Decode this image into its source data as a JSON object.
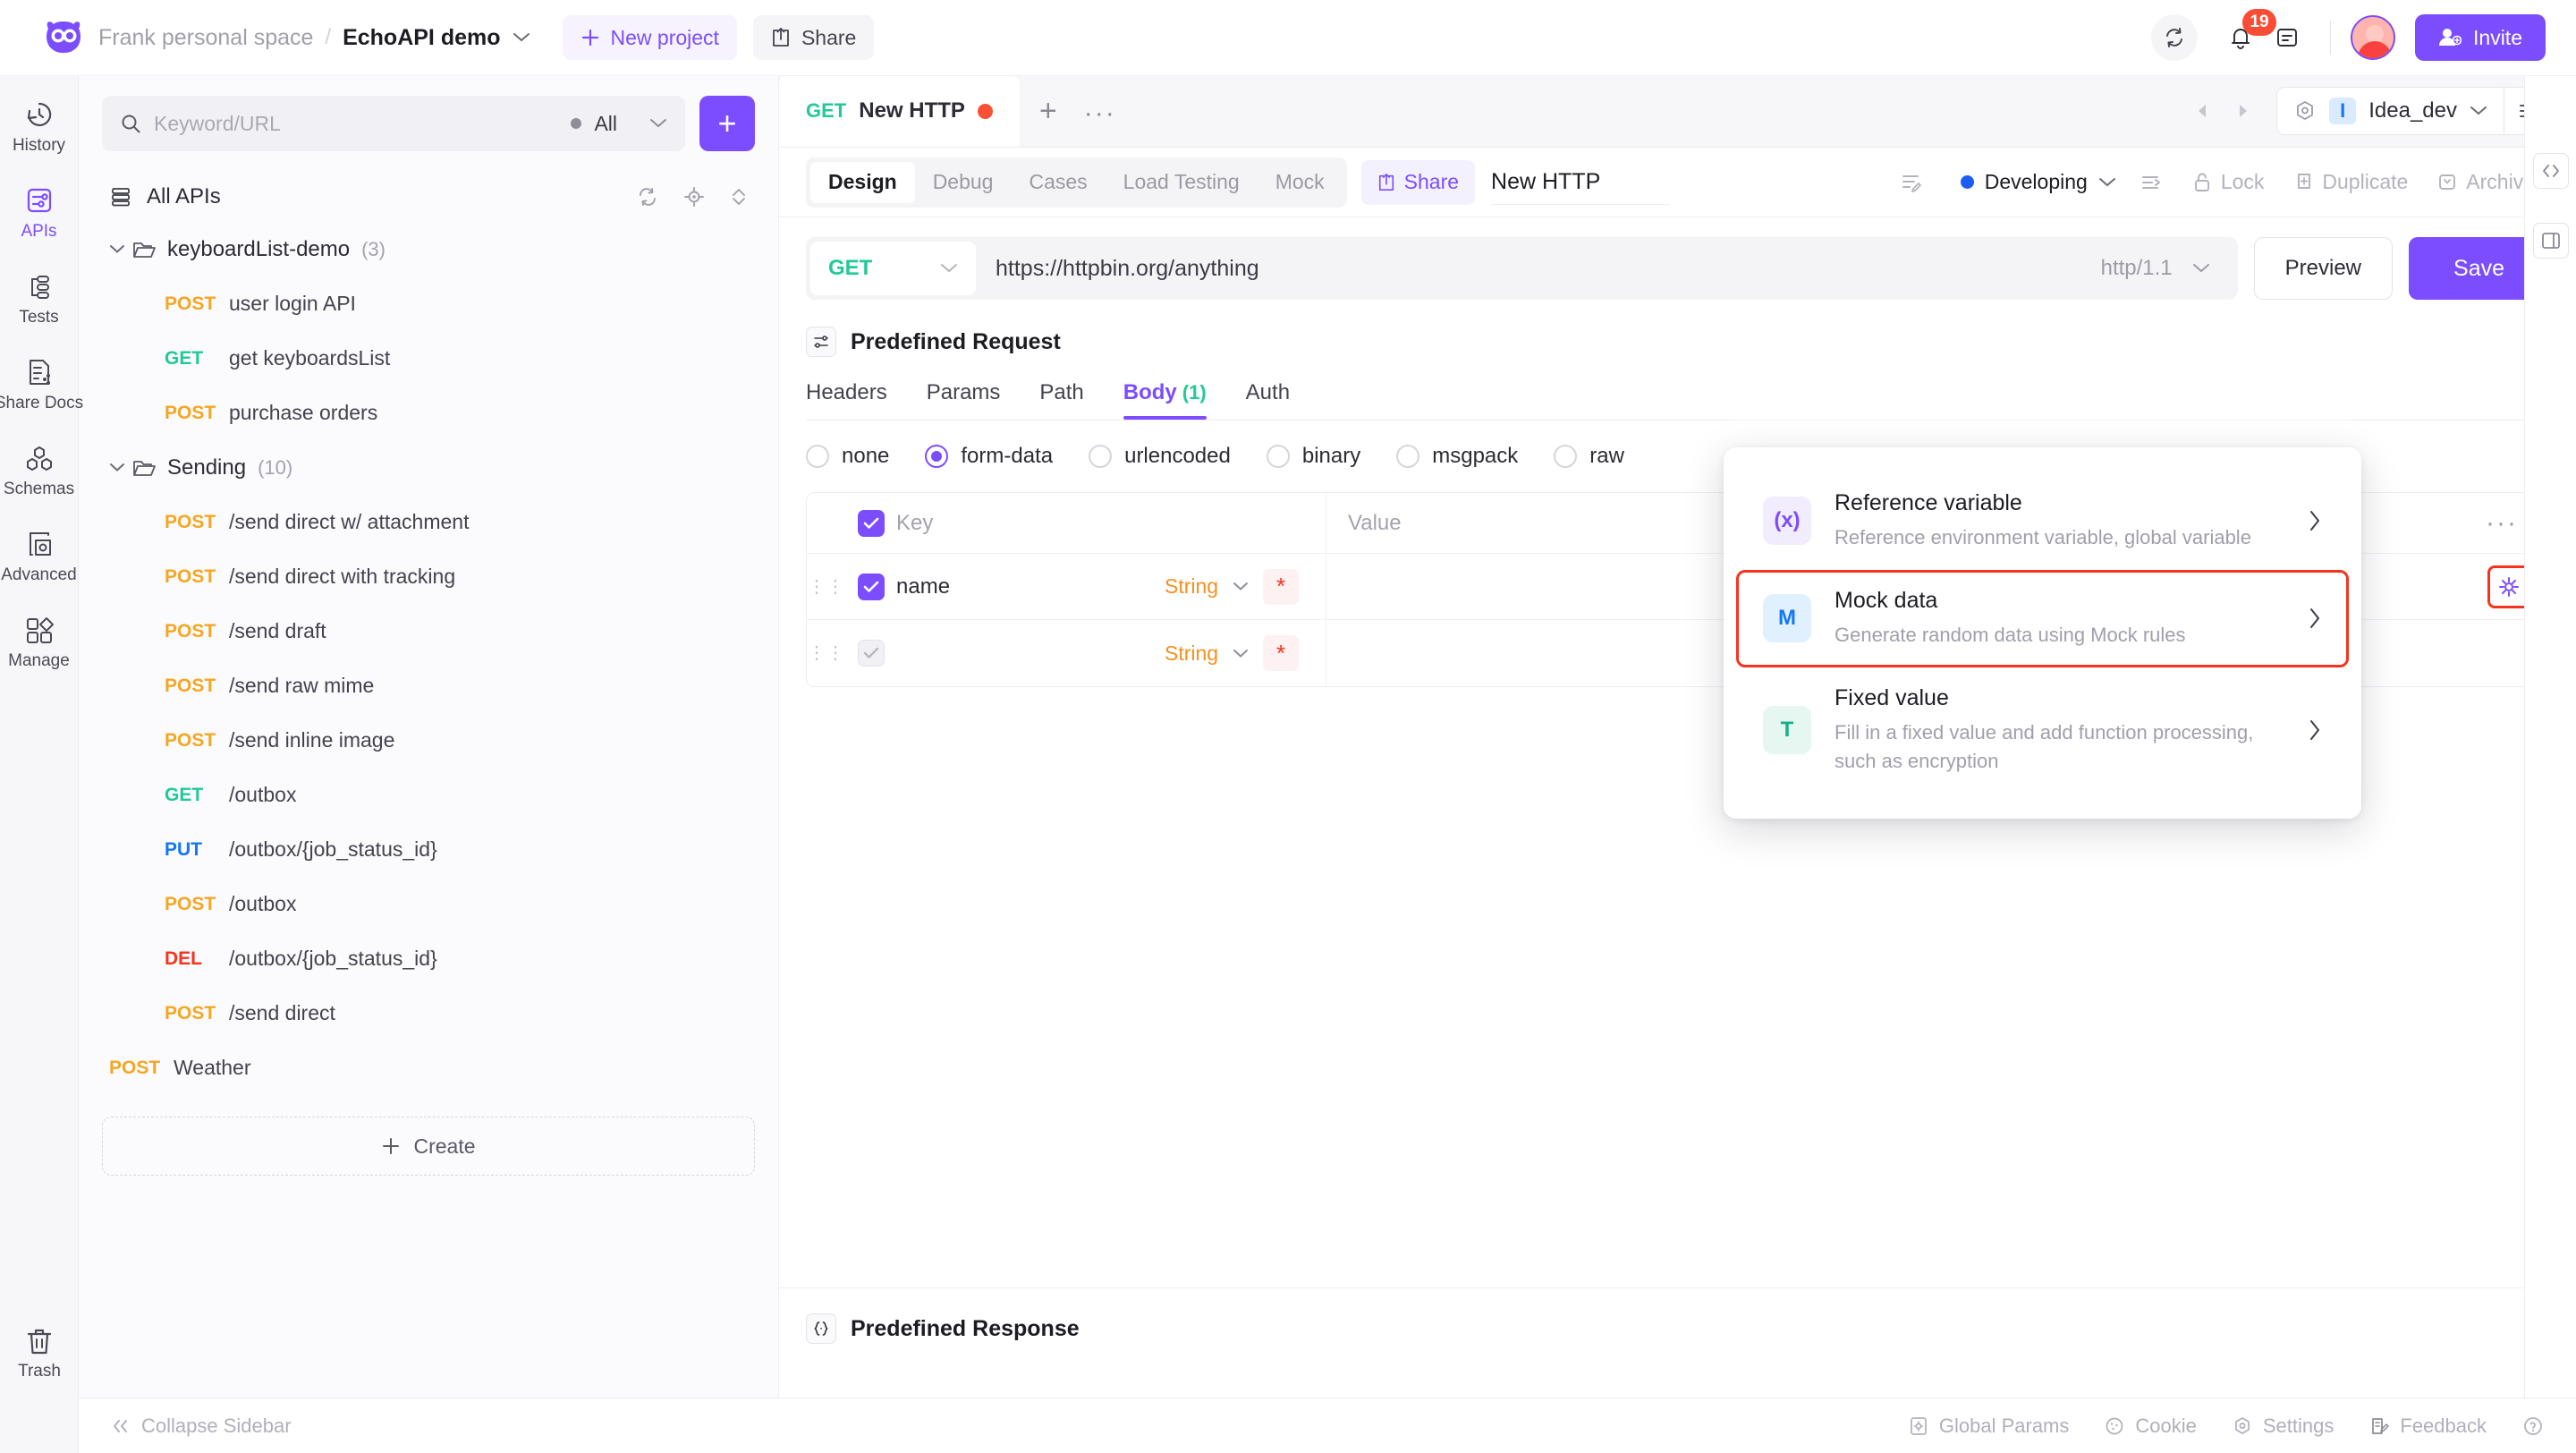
{
  "header": {
    "workspace": "Frank personal space",
    "separator": "/",
    "project": "EchoAPI demo",
    "new_project_label": "New project",
    "share_label": "Share",
    "notification_count": "19",
    "invite_label": "Invite",
    "icons": [
      "sync-icon",
      "bell-icon",
      "notes-icon",
      "avatar",
      "invite-user-icon"
    ]
  },
  "rail": {
    "items": [
      {
        "label": "History",
        "icon": "history-icon",
        "active": false
      },
      {
        "label": "APIs",
        "icon": "sliders-icon",
        "active": true
      },
      {
        "label": "Tests",
        "icon": "flow-icon",
        "active": false
      },
      {
        "label": "Share Docs",
        "icon": "share-doc-icon",
        "active": false
      },
      {
        "label": "Schemas",
        "icon": "schema-icon",
        "active": false
      },
      {
        "label": "Advanced",
        "icon": "advanced-icon",
        "active": false
      },
      {
        "label": "Manage",
        "icon": "manage-icon",
        "active": false
      }
    ],
    "trash_label": "Trash"
  },
  "sidebar": {
    "search_placeholder": "Keyword/URL",
    "filter_label": "All",
    "add_button": "+",
    "all_apis_label": "All APIs",
    "create_label": "Create",
    "tree": [
      {
        "type": "folder",
        "name": "keyboardList-demo",
        "count": "(3)",
        "expanded": true
      },
      {
        "type": "api",
        "method": "POST",
        "name": "user login API"
      },
      {
        "type": "api",
        "method": "GET",
        "name": "get keyboardsList"
      },
      {
        "type": "api",
        "method": "POST",
        "name": "purchase orders"
      },
      {
        "type": "folder",
        "name": "Sending",
        "count": "(10)",
        "expanded": true
      },
      {
        "type": "api",
        "method": "POST",
        "name": "/send direct w/ attachment"
      },
      {
        "type": "api",
        "method": "POST",
        "name": "/send direct with tracking"
      },
      {
        "type": "api",
        "method": "POST",
        "name": "/send draft"
      },
      {
        "type": "api",
        "method": "POST",
        "name": "/send raw mime"
      },
      {
        "type": "api",
        "method": "POST",
        "name": "/send inline image"
      },
      {
        "type": "api",
        "method": "GET",
        "name": "/outbox"
      },
      {
        "type": "api",
        "method": "PUT",
        "name": "/outbox/{job_status_id}"
      },
      {
        "type": "api",
        "method": "POST",
        "name": "/outbox"
      },
      {
        "type": "api",
        "method": "DEL",
        "name": "/outbox/{job_status_id}"
      },
      {
        "type": "api",
        "method": "POST",
        "name": "/send direct"
      },
      {
        "type": "api-root",
        "method": "POST",
        "name": "Weather"
      }
    ]
  },
  "doctab": {
    "method": "GET",
    "title": "New HTTP",
    "unsaved": true,
    "add_tab": "+",
    "more_tabs": "···"
  },
  "environment": {
    "chip": "I",
    "name": "Idea_dev"
  },
  "subtabs": {
    "tabs": [
      "Design",
      "Debug",
      "Cases",
      "Load Testing",
      "Mock"
    ],
    "active": "Design",
    "share_label": "Share",
    "name_value": "New HTTP",
    "status_label": "Developing",
    "actions": [
      "Lock",
      "Duplicate",
      "Archive"
    ]
  },
  "request": {
    "method": "GET",
    "url": "https://httpbin.org/anything",
    "protocol": "http/1.1",
    "preview_label": "Preview",
    "save_label": "Save"
  },
  "predefined_request": {
    "title": "Predefined Request",
    "tabs": [
      "Headers",
      "Params",
      "Path",
      "Body",
      "Auth"
    ],
    "active_tab": "Body",
    "body_count": "(1)",
    "body_types": [
      "none",
      "form-data",
      "urlencoded",
      "binary",
      "msgpack",
      "raw"
    ],
    "selected_body_type": "form-data",
    "table": {
      "columns": [
        "Key",
        "Value"
      ],
      "rows": [
        {
          "checked": true,
          "key": "name",
          "type": "String",
          "required": "*",
          "value": ""
        },
        {
          "checked": false,
          "key": "",
          "type": "String",
          "required": "*",
          "value": ""
        }
      ]
    }
  },
  "predefined_response": {
    "title": "Predefined Response"
  },
  "popup": {
    "items": [
      {
        "title": "Reference variable",
        "desc": "Reference environment variable, global variable",
        "icon": "(x)",
        "icon_name": "variable-icon",
        "selected": false
      },
      {
        "title": "Mock data",
        "desc": "Generate random data using Mock rules",
        "icon": "M",
        "icon_name": "mock-icon",
        "selected": true
      },
      {
        "title": "Fixed value",
        "desc": "Fill in a fixed value and add function processing, such as encryption",
        "icon": "T",
        "icon_name": "text-icon",
        "selected": false
      }
    ]
  },
  "statusbar": {
    "collapse_label": "Collapse Sidebar",
    "right_items": [
      "Global Params",
      "Cookie",
      "Settings",
      "Feedback"
    ]
  },
  "colors": {
    "accent": "#7c4dff",
    "get": "#22c99a",
    "post": "#f5a623",
    "put": "#1478f0",
    "del": "#f5341f",
    "highlight": "#f5341f",
    "status": "#1c5df5"
  }
}
